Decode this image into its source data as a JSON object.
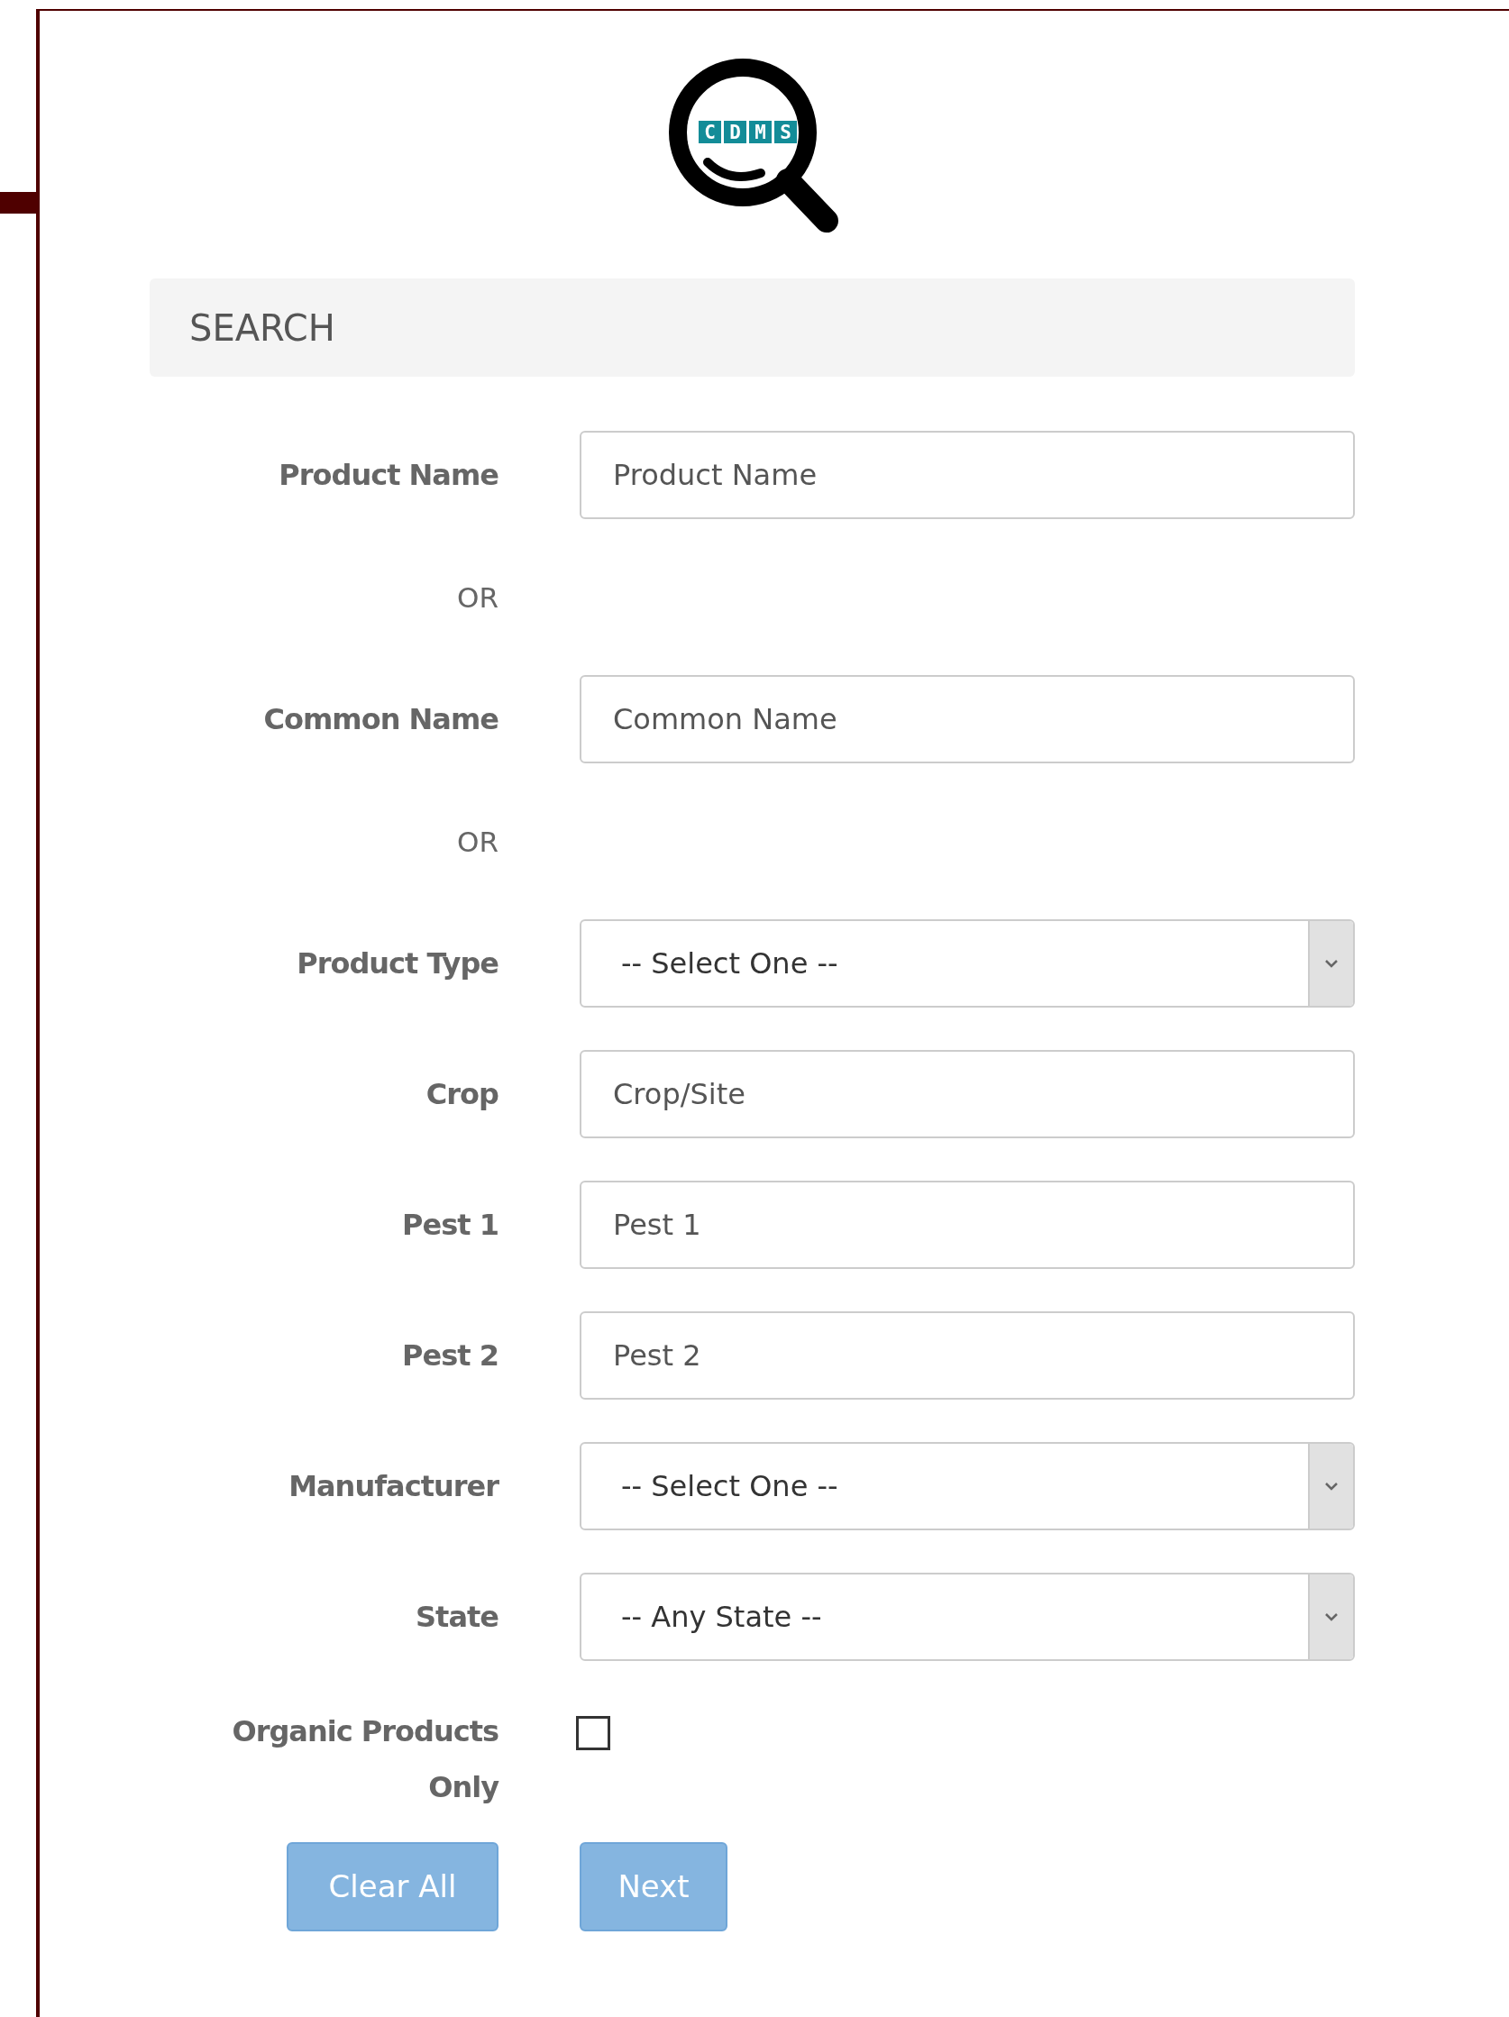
{
  "logo": {
    "text": [
      "C",
      "D",
      "M",
      "S"
    ]
  },
  "section_title": "SEARCH",
  "rows": [
    {
      "kind": "input",
      "label": "Product Name",
      "placeholder": "Product Name"
    },
    {
      "kind": "or",
      "text": "OR"
    },
    {
      "kind": "input",
      "label": "Common Name",
      "placeholder": "Common Name"
    },
    {
      "kind": "or",
      "text": "OR"
    },
    {
      "kind": "select",
      "label": "Product Type",
      "value": "-- Select One --"
    },
    {
      "kind": "input",
      "label": "Crop",
      "placeholder": "Crop/Site"
    },
    {
      "kind": "input",
      "label": "Pest 1",
      "placeholder": "Pest 1"
    },
    {
      "kind": "input",
      "label": "Pest 2",
      "placeholder": "Pest 2"
    },
    {
      "kind": "select",
      "label": "Manufacturer",
      "value": "-- Select One --"
    },
    {
      "kind": "select",
      "label": "State",
      "value": "-- Any State --"
    },
    {
      "kind": "checkbox",
      "label": "Organic Products Only",
      "checked": false
    }
  ],
  "buttons": [
    "Clear All",
    "Next"
  ]
}
